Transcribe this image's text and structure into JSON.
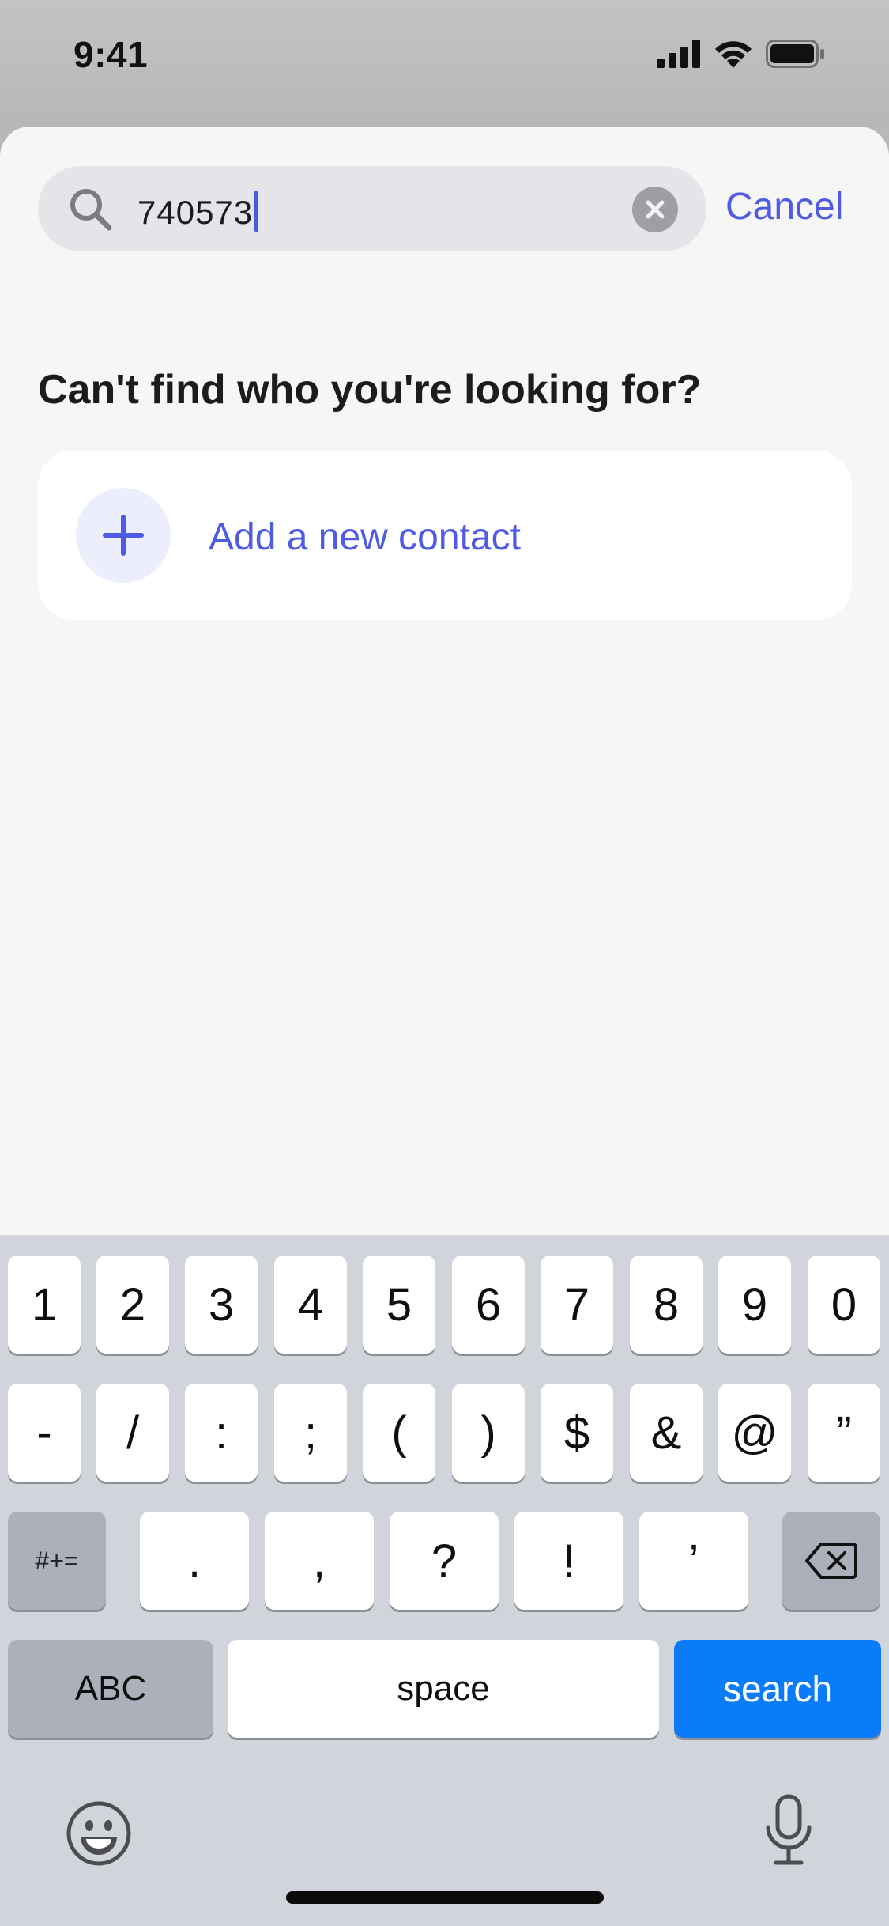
{
  "status_bar": {
    "time": "9:41",
    "icons": [
      "cellular-signal-icon",
      "wifi-icon",
      "battery-icon"
    ]
  },
  "search": {
    "value": "740573",
    "icon": "search-icon",
    "clear_icon": "clear-icon",
    "cancel_label": "Cancel"
  },
  "heading": "Can't find who you're looking for?",
  "add_contact": {
    "icon": "plus-icon",
    "label": "Add a new contact"
  },
  "keyboard": {
    "row1": [
      "1",
      "2",
      "3",
      "4",
      "5",
      "6",
      "7",
      "8",
      "9",
      "0"
    ],
    "row2": [
      "-",
      "/",
      ":",
      ";",
      "(",
      ")",
      "$",
      "&",
      "@",
      "”"
    ],
    "symbols_label": "#+=",
    "row3": [
      ".",
      ",",
      "?",
      "!",
      "’"
    ],
    "backspace_icon": "backspace-icon",
    "abc_label": "ABC",
    "space_label": "space",
    "search_label": "search",
    "emoji_icon": "emoji-icon",
    "mic_icon": "microphone-icon"
  },
  "colors": {
    "accent": "#4f5be5",
    "search_key": "#0a7cfa",
    "sheet_background": "#f6f6f7",
    "keyboard_background": "#d1d4da"
  }
}
